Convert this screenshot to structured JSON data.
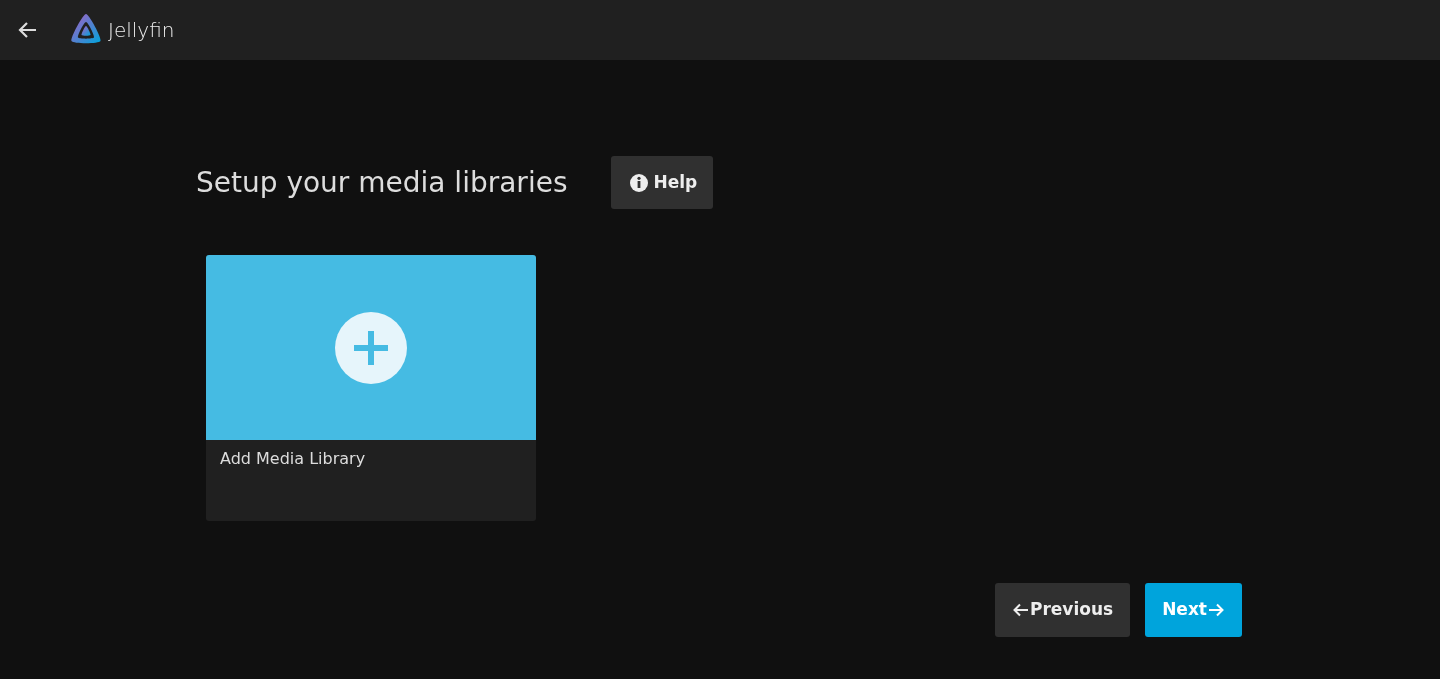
{
  "header": {
    "app_name": "Jellyfin"
  },
  "page": {
    "title": "Setup your media libraries",
    "help_button": "Help"
  },
  "libraries": [
    {
      "kind": "add",
      "label": "Add Media Library"
    }
  ],
  "buttons": [
    {
      "kind": "previous",
      "label": "Previous"
    },
    {
      "kind": "next",
      "label": "Next"
    }
  ]
}
